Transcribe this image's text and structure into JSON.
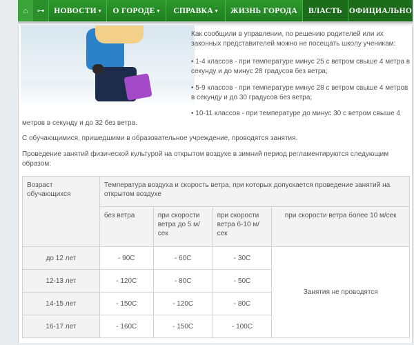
{
  "nav": {
    "items": [
      {
        "label": "НОВОСТИ",
        "caret": "▾"
      },
      {
        "label": "О ГОРОДЕ",
        "caret": "▾"
      },
      {
        "label": "СПРАВКА",
        "caret": "▾"
      },
      {
        "label": "ЖИЗНЬ ГОРОДА",
        "caret": ""
      },
      {
        "label": "ВЛАСТЬ",
        "caret": ""
      },
      {
        "label": "ОФИЦИАЛЬНО",
        "caret": ""
      }
    ],
    "home_icon": "⌂",
    "rss_icon": "⊶"
  },
  "article": {
    "intro": "Как сообщили в управлении, по решению родителей или их законных представителей можно не посещать школу ученикам:",
    "rule1": "• 1-4 классов - при температуре минус 25 с ветром свыше 4 метра в секунду и до минус 28 градусов без ветра;",
    "rule2": "• 5-9 классов - при температуре минус 28 с ветром свыше 4 метров в секунду и до 30 градусов без ветра;",
    "rule3_start": "• 10-11 классов - при температуре до минус 30 с ветром свыше 4",
    "rule3_end": "метров в секунду и до 32 без ветра.",
    "para2": "С обучающимися, пришедшими в образовательное учреждение, проводятся занятия.",
    "para3": "Проведение занятий физической культурой на открытом воздухе в зимний период регламентируются следующим образом:"
  },
  "table": {
    "head_age": "Возраст обучающихся",
    "head_temp": "Температура воздуха и скорость ветра, при которых допускается проведение занятий на открытом воздухе",
    "col_nowind": "без ветра",
    "col_wind5": "при скорости ветра до 5 м/сек",
    "col_wind6_10": "при скорости ветра 6-10 м/сек",
    "col_wind10": "при скорости ветра более 10 м/сек",
    "no_classes": "Занятия не проводятся",
    "rows": [
      {
        "age": "до 12 лет",
        "v1": "- 90С",
        "v2": "- 60С",
        "v3": "- 30С"
      },
      {
        "age": "12-13 лет",
        "v1": "- 120С",
        "v2": "- 80С",
        "v3": "- 50С"
      },
      {
        "age": "14-15 лет",
        "v1": "- 150С",
        "v2": "- 120С",
        "v3": "- 80С"
      },
      {
        "age": "16-17 лет",
        "v1": "- 160С",
        "v2": "- 150С",
        "v3": "- 100С"
      }
    ]
  },
  "colors": {
    "nav_green": "#1f7d1f",
    "text": "#555555"
  }
}
